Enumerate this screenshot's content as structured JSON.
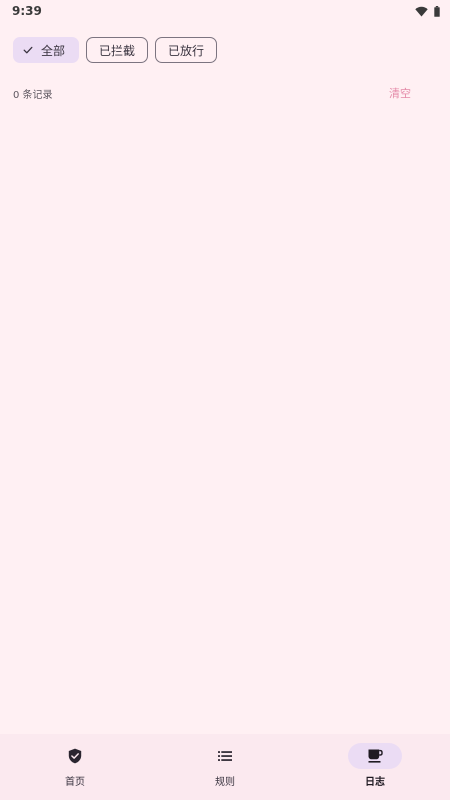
{
  "status_bar": {
    "time": "9:39"
  },
  "filters": {
    "chips": [
      {
        "label": "全部",
        "selected": true
      },
      {
        "label": "已拦截",
        "selected": false
      },
      {
        "label": "已放行",
        "selected": false
      }
    ]
  },
  "records": {
    "count_text": "0 条记录",
    "clear_label": "清空"
  },
  "bottom_nav": {
    "items": [
      {
        "label": "首页",
        "icon": "shield-check-icon",
        "active": false
      },
      {
        "label": "规则",
        "icon": "list-icon",
        "active": false
      },
      {
        "label": "日志",
        "icon": "coffee-cup-icon",
        "active": true
      }
    ]
  },
  "colors": {
    "background": "#fff0f3",
    "selected_chip": "#ebdcf4",
    "clear_text": "#e48aa8",
    "nav_background": "#fbe9ef"
  }
}
